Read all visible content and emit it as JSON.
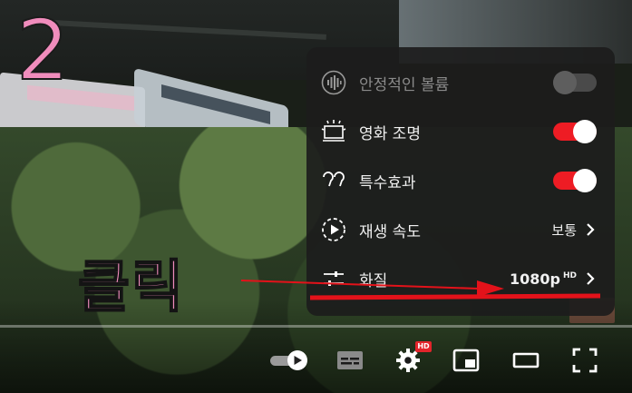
{
  "overlay": {
    "step_number": "2",
    "click_label": "클릭"
  },
  "settings_menu": {
    "items": [
      {
        "label": "안정적인 볼륨",
        "icon": "stable-volume-icon",
        "type": "toggle",
        "toggled": false,
        "disabled": true
      },
      {
        "label": "영화 조명",
        "icon": "ambient-mode-icon",
        "type": "toggle",
        "toggled": true,
        "disabled": false
      },
      {
        "label": "특수효과",
        "icon": "annotations-icon",
        "type": "toggle",
        "toggled": true,
        "disabled": false
      },
      {
        "label": "재생 속도",
        "icon": "playback-speed-icon",
        "type": "submenu",
        "value": "보통",
        "disabled": false
      },
      {
        "label": "화질",
        "icon": "quality-icon",
        "type": "submenu",
        "value": "1080p",
        "value_sup": "HD",
        "disabled": false
      }
    ]
  },
  "player_controls": {
    "hd_badge": "HD",
    "buttons": [
      "autoplay-toggle",
      "subtitles-button",
      "settings-button",
      "miniplayer-button",
      "theater-mode-button",
      "fullscreen-button"
    ]
  },
  "colors": {
    "accent_red": "#ee1c24",
    "annotation_pink": "#f08cbc",
    "menu_bg": "#1c1c1c",
    "arrow_red": "#e3121a"
  }
}
